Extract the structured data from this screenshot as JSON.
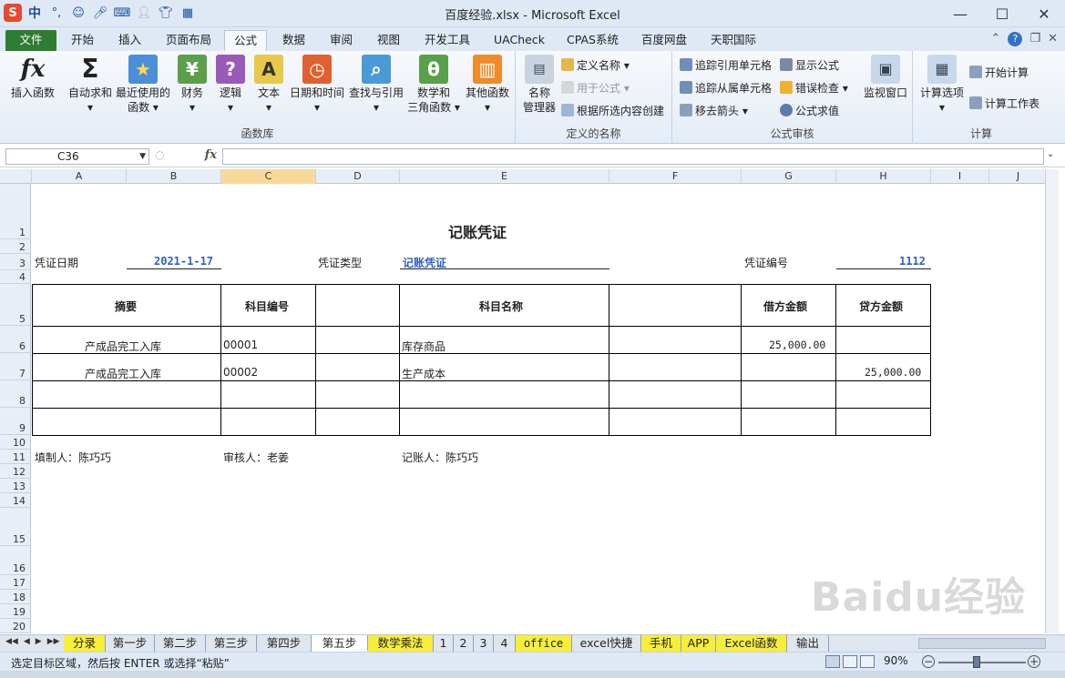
{
  "app": {
    "window_title": "百度经验.xlsx - Microsoft Excel",
    "qat_icons": [
      "sogou-icon",
      "zh-input-icon",
      "punctuation-icon",
      "emoji-icon",
      "mic-icon",
      "keyboard-icon",
      "user-icon",
      "shirt-icon",
      "grid-icon"
    ],
    "qat_zh": "中",
    "qat_sogou": "S",
    "qat_punct": "°,"
  },
  "tabs": [
    {
      "label": "文件"
    },
    {
      "label": "开始"
    },
    {
      "label": "插入"
    },
    {
      "label": "页面布局"
    },
    {
      "label": "公式"
    },
    {
      "label": "数据"
    },
    {
      "label": "审阅"
    },
    {
      "label": "视图"
    },
    {
      "label": "开发工具"
    },
    {
      "label": "UACheck"
    },
    {
      "label": "CPAS系统"
    },
    {
      "label": "百度网盘"
    },
    {
      "label": "天职国际"
    }
  ],
  "ribbon": {
    "groups": {
      "library": "函数库",
      "names": "定义的名称",
      "audit": "公式审核",
      "calc": "计算"
    },
    "lib_buttons": [
      {
        "l1": "插入函数",
        "l2": ""
      },
      {
        "l1": "自动求和",
        "l2": "▾"
      },
      {
        "l1": "最近使用的",
        "l2": "函数 ▾"
      },
      {
        "l1": "财务",
        "l2": "▾"
      },
      {
        "l1": "逻辑",
        "l2": "▾"
      },
      {
        "l1": "文本",
        "l2": "▾"
      },
      {
        "l1": "日期和时间",
        "l2": "▾"
      },
      {
        "l1": "查找与引用",
        "l2": "▾"
      },
      {
        "l1": "数学和",
        "l2": "三角函数 ▾"
      },
      {
        "l1": "其他函数",
        "l2": "▾"
      }
    ],
    "name_manager": {
      "l1": "名称",
      "l2": "管理器"
    },
    "name_small": [
      "定义名称 ▾",
      "用于公式 ▾",
      "根据所选内容创建"
    ],
    "audit_small": [
      "追踪引用单元格",
      "追踪从属单元格",
      "移去箭头 ▾",
      "显示公式",
      "错误检查 ▾",
      "公式求值"
    ],
    "watch": "监视窗口",
    "calc_options": {
      "l1": "计算选项",
      "l2": "▾"
    },
    "calc_small": [
      "开始计算",
      "计算工作表"
    ]
  },
  "formula_bar": {
    "name_box": "C36",
    "fx": "fx",
    "value": ""
  },
  "columns": [
    "A",
    "B",
    "C",
    "D",
    "E",
    "F",
    "G",
    "H",
    "I",
    "J"
  ],
  "rows": [
    "1",
    "2",
    "3",
    "4",
    "5",
    "6",
    "7",
    "8",
    "9",
    "10",
    "11",
    "12",
    "13",
    "14",
    "15",
    "16",
    "17",
    "18",
    "19",
    "20"
  ],
  "voucher": {
    "title": "记账凭证",
    "date_label": "凭证日期",
    "date_value": "2021-1-17",
    "type_label": "凭证类型",
    "type_value": "记账凭证",
    "no_label": "凭证编号",
    "no_value": "1112",
    "headers": {
      "summary": "摘要",
      "code": "科目编号",
      "name": "科目名称",
      "debit": "借方金额",
      "credit": "贷方金额"
    },
    "lines": [
      {
        "summary": "产成品完工入库",
        "code": "00001",
        "name": "库存商品",
        "debit": "25,000.00",
        "credit": ""
      },
      {
        "summary": "产成品完工入库",
        "code": "00002",
        "name": "生产成本",
        "debit": "",
        "credit": "25,000.00"
      }
    ],
    "preparer": "填制人：陈巧巧",
    "reviewer": "审核人：老姜",
    "bookkeeper": "记账人：陈巧巧"
  },
  "sheet_tabs": [
    {
      "label": "分录",
      "style": "yellow"
    },
    {
      "label": "第一步",
      "style": "grey"
    },
    {
      "label": "第二步",
      "style": "grey"
    },
    {
      "label": "第三步",
      "style": "grey"
    },
    {
      "label": "第四步",
      "style": "grey"
    },
    {
      "label": "第五步",
      "style": "active"
    },
    {
      "label": "数学乘法",
      "style": "yellow"
    },
    {
      "label": "1",
      "style": "grey"
    },
    {
      "label": "2",
      "style": "grey"
    },
    {
      "label": "3",
      "style": "grey"
    },
    {
      "label": "4",
      "style": "grey"
    },
    {
      "label": "office",
      "style": "yellow"
    },
    {
      "label": "excel快捷",
      "style": "grey"
    },
    {
      "label": "手机",
      "style": "yellow"
    },
    {
      "label": "APP",
      "style": "yellow"
    },
    {
      "label": "Excel函数",
      "style": "yellow"
    },
    {
      "label": "输出",
      "style": "grey"
    }
  ],
  "status": {
    "message": "选定目标区域，然后按 ENTER 或选择“粘贴”",
    "zoom": "90%",
    "zoom_level": 0.9
  },
  "watermark": "Baidu经验",
  "colors": {
    "accent": "#2e7d32",
    "link_blue": "#2f5fbf",
    "selected_col": "#f9d999",
    "yellow_tab": "#f7ee3a"
  }
}
